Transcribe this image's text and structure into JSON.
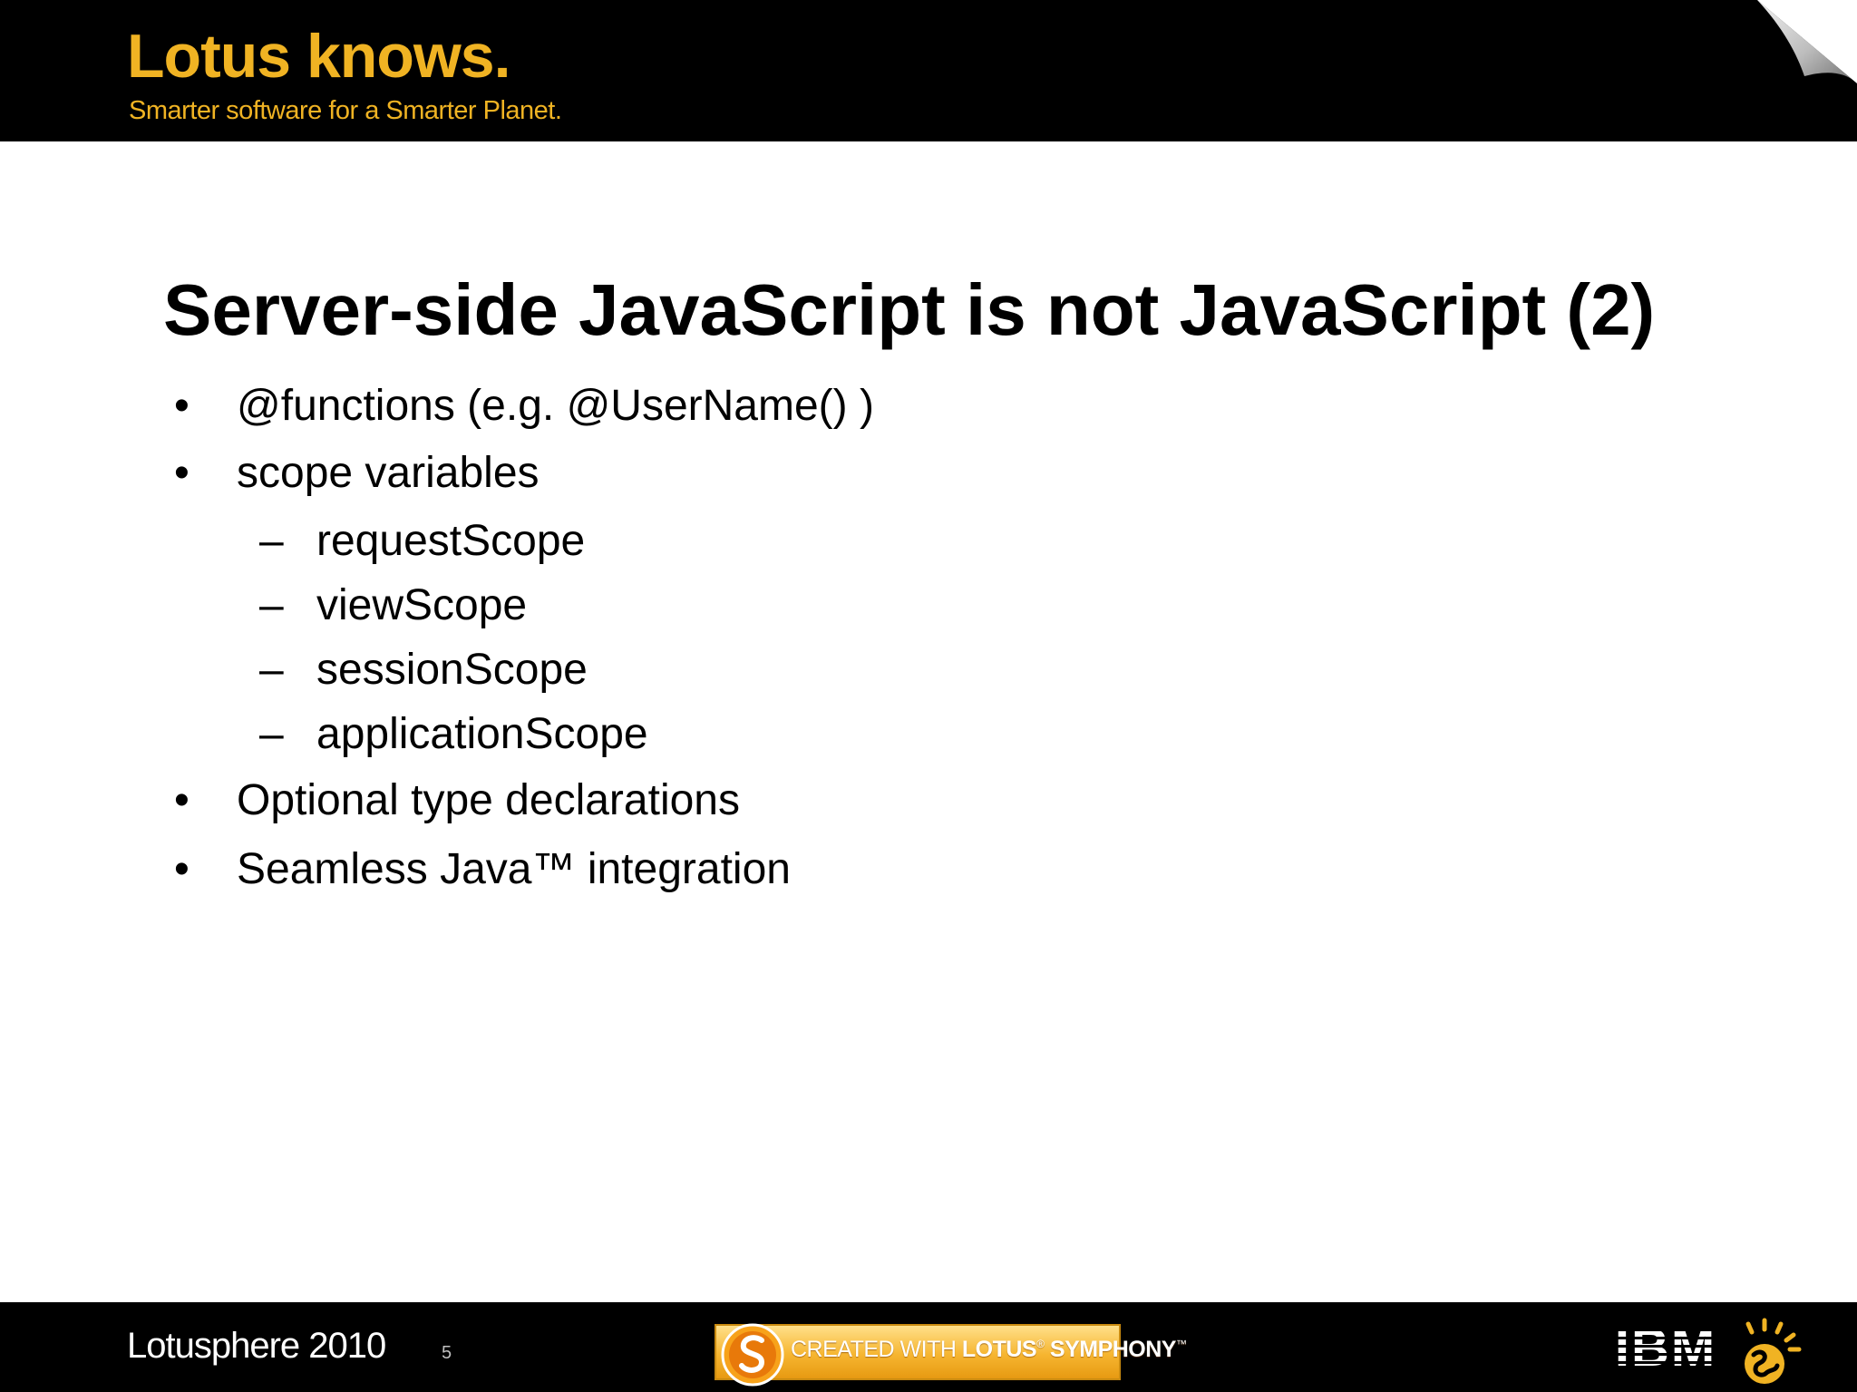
{
  "header": {
    "brand_title": "Lotus knows.",
    "tagline": "Smarter software for a Smarter Planet."
  },
  "slide": {
    "title": "Server-side JavaScript is not JavaScript (2)",
    "bullet_char": "•",
    "dash_char": "–",
    "bullets": [
      {
        "level": 1,
        "text": "@functions (e.g. @UserName() )"
      },
      {
        "level": 1,
        "text": "scope variables"
      },
      {
        "level": 2,
        "text": "requestScope"
      },
      {
        "level": 2,
        "text": "viewScope"
      },
      {
        "level": 2,
        "text": "sessionScope"
      },
      {
        "level": 2,
        "text": "applicationScope"
      },
      {
        "level": 1,
        "text": "Optional type declarations"
      },
      {
        "level": 1,
        "text": "Seamless Java™ integration"
      }
    ]
  },
  "footer": {
    "event_name": "Lotusphere 2010",
    "slide_number": "5",
    "badge_prefix": "CREATED WITH",
    "badge_brand": "LOTUS",
    "badge_product": "SYMPHONY",
    "badge_reg_mark": "®",
    "badge_tm_mark": "™",
    "ibm_logo_text": "IBM"
  },
  "colors": {
    "brand_gold": "#f0b323",
    "band_black": "#000000",
    "badge_orange": "#f6b530"
  },
  "icons": {
    "page_curl": "page-curl-icon",
    "symphony": "symphony-logo-icon",
    "ibm": "ibm-logo",
    "planet": "smarter-planet-icon"
  }
}
